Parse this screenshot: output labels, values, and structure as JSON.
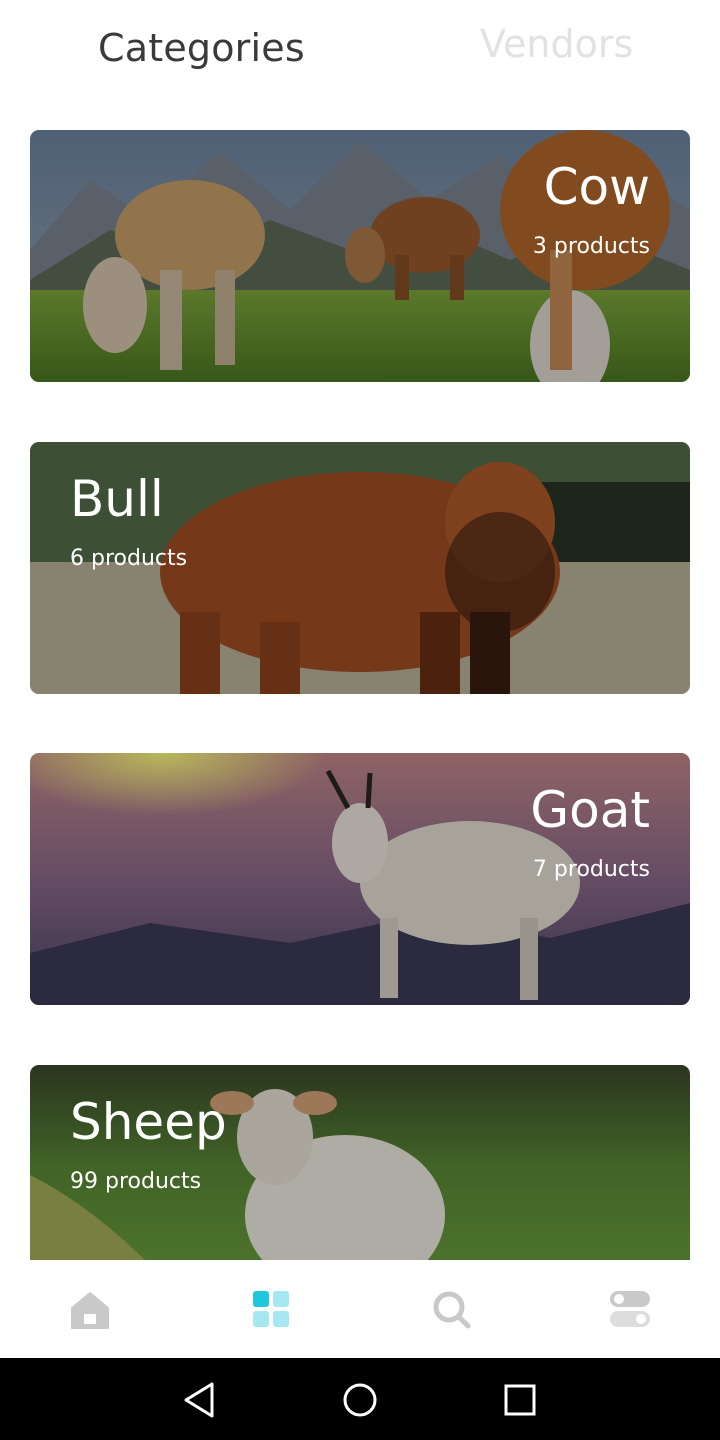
{
  "header": {
    "tabs": [
      {
        "label": "Categories",
        "active": true
      },
      {
        "label": "Vendors",
        "active": false
      }
    ]
  },
  "categories": [
    {
      "name": "Cow",
      "count": "3 products",
      "image": "cows-grazing-mountain-meadow"
    },
    {
      "name": "Bull",
      "count": "6 products",
      "image": "brown-bull-in-field"
    },
    {
      "name": "Goat",
      "count": "7 products",
      "image": "mountain-goat-at-sunset"
    },
    {
      "name": "Sheep",
      "count": "99 products",
      "image": "white-sheep-on-grass"
    }
  ],
  "bottom_nav": {
    "items": [
      {
        "icon": "home-icon",
        "active": false
      },
      {
        "icon": "categories-grid-icon",
        "active": true
      },
      {
        "icon": "search-icon",
        "active": false
      },
      {
        "icon": "settings-toggle-icon",
        "active": false
      }
    ]
  },
  "system_nav": {
    "buttons": [
      "back-icon",
      "home-circle-icon",
      "recents-square-icon"
    ]
  },
  "colors": {
    "accent": "#1fc6dc",
    "inactive_icon": "#c9c9c9",
    "title_text": "#3a3a3a",
    "inactive_tab_text": "#e2e2e2"
  }
}
